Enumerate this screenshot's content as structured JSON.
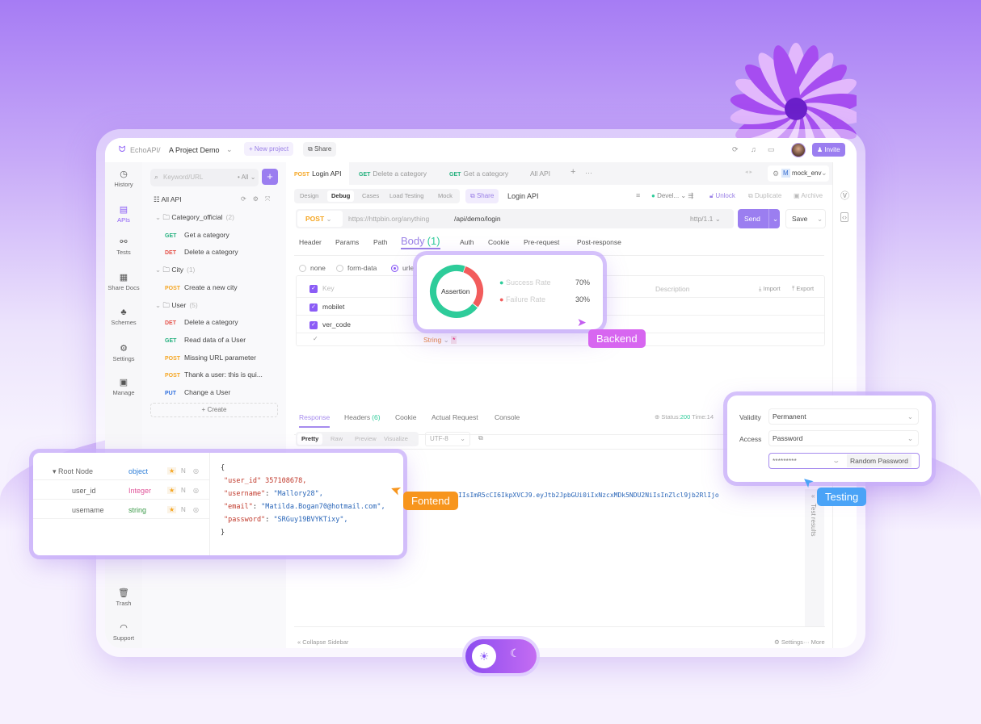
{
  "colors": {
    "accent": "#8b5cf6",
    "success": "#2ecc9a",
    "failure": "#f25c5c",
    "frontend": "#f7951d",
    "backend": "#d766f0",
    "testing": "#4aa3f7"
  },
  "topbar": {
    "brand": "EchoAPI/",
    "project": "A Project Demo",
    "new_project": "+ New project",
    "share": "Share",
    "invite": "Invite"
  },
  "rail": {
    "items": [
      {
        "label": "History",
        "icon": "clock-icon"
      },
      {
        "label": "APIs",
        "icon": "api-icon"
      },
      {
        "label": "Tests",
        "icon": "tests-icon"
      },
      {
        "label": "Share Docs",
        "icon": "docs-icon"
      },
      {
        "label": "Schemes",
        "icon": "schemes-icon"
      },
      {
        "label": "Settings",
        "icon": "settings-icon"
      },
      {
        "label": "Manage",
        "icon": "manage-icon"
      }
    ],
    "trash": "Trash",
    "support": "Support"
  },
  "sidebar": {
    "search_placeholder": "Keyword/URL",
    "filter": "All",
    "all_api": "All API",
    "create": "+ Create",
    "tree": [
      {
        "type": "folder",
        "label": "Category_official",
        "count": "(2)"
      },
      {
        "type": "api",
        "method": "GET",
        "label": "Get a category"
      },
      {
        "type": "api",
        "method": "DET",
        "label": "Delete a category"
      },
      {
        "type": "folder",
        "label": "City",
        "count": "(1)"
      },
      {
        "type": "api",
        "method": "POST",
        "label": "Create a new city"
      },
      {
        "type": "folder",
        "label": "User",
        "count": "(5)"
      },
      {
        "type": "api",
        "method": "DET",
        "label": "Delete a category"
      },
      {
        "type": "api",
        "method": "GET",
        "label": "Read data of a User"
      },
      {
        "type": "api",
        "method": "POST",
        "label": "Missing URL parameter"
      },
      {
        "type": "api",
        "method": "POST",
        "label": "Thank a user: this is qui..."
      },
      {
        "type": "api",
        "method": "PUT",
        "label": "Change a User"
      }
    ]
  },
  "tabs": [
    {
      "method": "POST",
      "label": "Login API"
    },
    {
      "method": "GET",
      "label": "Delete a category"
    },
    {
      "method": "GET",
      "label": "Get a category"
    },
    {
      "method": "",
      "label": "All API"
    }
  ],
  "env": {
    "label": "mock_env",
    "badge": "M"
  },
  "subtabs": [
    "Design",
    "Debug",
    "Cases",
    "Load Testing",
    "Mock"
  ],
  "toolbar": {
    "share": "Share",
    "api_name": "Login API",
    "env_status": "Devel...",
    "unlock": "Unlock",
    "duplicate": "Duplicate",
    "archive": "Archive"
  },
  "request": {
    "method": "POST",
    "base_url": "https://httpbin.org/anything",
    "path": "/api/demo/login",
    "protocol": "http/1.1",
    "send": "Send",
    "save": "Save"
  },
  "req_tabs": [
    "Header",
    "Params",
    "Path",
    "Body",
    "Auth",
    "Cookie",
    "Pre-request",
    "Post-response"
  ],
  "body_count": "(1)",
  "body_types": [
    "none",
    "form-data",
    "urle"
  ],
  "params": {
    "headers": {
      "key": "Key",
      "description": "Description",
      "import": "Import",
      "export": "Export"
    },
    "rows": [
      "mobilet",
      "ver_code"
    ],
    "new_type": "String"
  },
  "assertion": {
    "label": "Assertion",
    "success_label": "Success Rate",
    "success": 70,
    "success_text": "70%",
    "failure_label": "Failure Rate",
    "failure": 30,
    "failure_text": "30%"
  },
  "badges": {
    "backend": "Backend",
    "frontend": "Fontend",
    "testing": "Testing"
  },
  "response": {
    "tabs": [
      "Response",
      "Headers",
      "Cookie",
      "Actual Request",
      "Console"
    ],
    "headers_count": "(6)",
    "status_label": "Status:",
    "status": "200",
    "time_label": "Time:14",
    "views": [
      "Pretty",
      "Raw",
      "Preview",
      "Visualize"
    ],
    "encoding": "UTF-8",
    "token": "IIsImR5cCI6IkpXVCJ9.eyJtb2JpbGUi0iIxNzcxMDk5NDU2NiIsInZlcl9jb2RlIjo",
    "test_results": "Test results"
  },
  "schema": {
    "rows": [
      {
        "name": "Root Node",
        "type": "object"
      },
      {
        "name": "user_id",
        "type": "Integer"
      },
      {
        "name": "usemame",
        "type": "string"
      }
    ],
    "flag": "N",
    "json": [
      [
        "{",
        "",
        ""
      ],
      [
        "\"user_id\"",
        " 357108678,",
        ""
      ],
      [
        "\"username\"",
        ": ",
        "\"Mallory28\","
      ],
      [
        "\"email\"",
        ": ",
        "\"Matilda.Bogan70@hotmail.com\","
      ],
      [
        "\"password\"",
        ": ",
        "\"SRGuy19BVYKTixy\","
      ],
      [
        "}",
        "",
        ""
      ]
    ]
  },
  "share_panel": {
    "validity_label": "Validity",
    "validity": "Permanent",
    "access_label": "Access",
    "access": "Password",
    "password": "*********",
    "random": "Random Password"
  },
  "footer": {
    "collapse": "Collapse Sidebar",
    "settings": "Settings",
    "more": "More"
  }
}
